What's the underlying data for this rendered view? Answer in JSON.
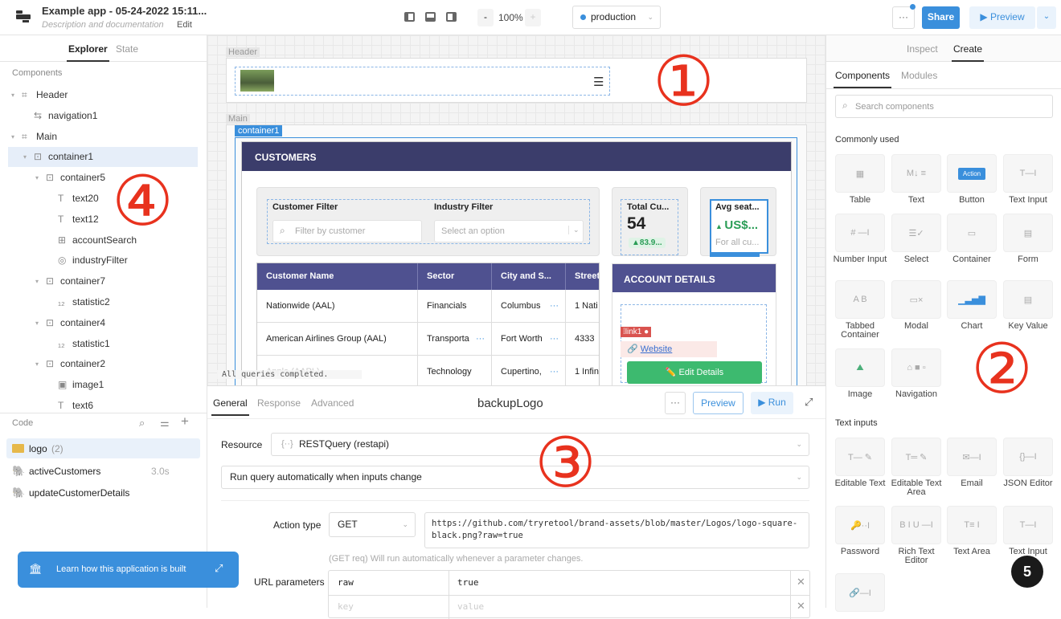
{
  "topbar": {
    "title": "Example app - 05-24-2022 15:11...",
    "subtitle": "Description and documentation",
    "edit": "Edit",
    "zoom_minus": "-",
    "zoom": "100%",
    "zoom_plus": "+",
    "environment": "production",
    "more": "···",
    "share": "Share",
    "preview": "Preview"
  },
  "left": {
    "tabs": [
      "Explorer",
      "State"
    ],
    "components_heading": "Components",
    "tree": [
      {
        "label": "Header",
        "icon": "frame-icon",
        "depth": 0,
        "caret": true
      },
      {
        "label": "navigation1",
        "icon": "navigation-icon",
        "depth": 1,
        "caret": false
      },
      {
        "label": "Main",
        "icon": "frame-icon",
        "depth": 0,
        "caret": true
      },
      {
        "label": "container1",
        "icon": "container-icon",
        "depth": 1,
        "caret": true,
        "selected": true
      },
      {
        "label": "container5",
        "icon": "container-icon",
        "depth": 2,
        "caret": true
      },
      {
        "label": "text20",
        "icon": "text-icon",
        "depth": 3,
        "caret": false
      },
      {
        "label": "text12",
        "icon": "text-icon",
        "depth": 3,
        "caret": false
      },
      {
        "label": "accountSearch",
        "icon": "text-input-icon",
        "depth": 3,
        "caret": false
      },
      {
        "label": "industryFilter",
        "icon": "select-icon",
        "depth": 3,
        "caret": false
      },
      {
        "label": "container7",
        "icon": "container-icon",
        "depth": 2,
        "caret": true
      },
      {
        "label": "statistic2",
        "icon": "statistic-icon",
        "depth": 3,
        "caret": false
      },
      {
        "label": "container4",
        "icon": "container-icon",
        "depth": 2,
        "caret": true
      },
      {
        "label": "statistic1",
        "icon": "statistic-icon",
        "depth": 3,
        "caret": false
      },
      {
        "label": "container2",
        "icon": "container-icon",
        "depth": 2,
        "caret": true
      },
      {
        "label": "image1",
        "icon": "image-icon",
        "depth": 3,
        "caret": false
      },
      {
        "label": "text6",
        "icon": "text-icon",
        "depth": 3,
        "caret": false
      }
    ],
    "code_heading": "Code",
    "code": [
      {
        "label": "logo",
        "count": "(2)",
        "icon": "folder-icon"
      },
      {
        "label": "activeCustomers",
        "time": "3.0s",
        "icon": "postgres-icon"
      },
      {
        "label": "updateCustomerDetails",
        "icon": "postgres-icon"
      }
    ],
    "learn": "Learn how this application is built"
  },
  "canvas": {
    "header_label": "Header",
    "main_label": "Main",
    "container_tag": "container1",
    "customers_title": "CUSTOMERS",
    "customer_filter": "Customer Filter",
    "customer_placeholder": "Filter by customer",
    "industry_filter": "Industry Filter",
    "industry_placeholder": "Select an option",
    "stat1": {
      "title": "Total Cu...",
      "value": "54",
      "delta": "83.9..."
    },
    "stat2": {
      "title": "Avg seat...",
      "value": "US$...",
      "sub": "For all cu..."
    },
    "table": {
      "columns": [
        "Customer Name",
        "Sector",
        "City and S...",
        "Street"
      ],
      "rows": [
        [
          "Nationwide (AAL)",
          "Financials",
          "Columbus",
          "1 Nati"
        ],
        [
          "American Airlines Group (AAL)",
          "Transporta",
          "Fort Worth",
          "4333"
        ],
        [
          "Apple (AAPL)",
          "Technology",
          "Cupertino,",
          "1 Infin"
        ]
      ]
    },
    "account_details": "ACCOUNT DETAILS",
    "link_tag": "link1",
    "website": "Website",
    "edit_details": "✏️ Edit Details",
    "status": "All queries completed."
  },
  "query": {
    "tabs": [
      "General",
      "Response",
      "Advanced"
    ],
    "name": "backupLogo",
    "more": "···",
    "preview": "Preview",
    "run": "Run",
    "resource_label": "Resource",
    "resource": "RESTQuery (restapi)",
    "trigger": "Run query automatically when inputs change",
    "action_label": "Action type",
    "method": "GET",
    "url": "https://github.com/tryretool/brand-assets/blob/master/Logos/logo-square-black.png?raw=true",
    "hint": "(GET req) Will run automatically whenever a parameter changes.",
    "params_label": "URL parameters",
    "params": [
      {
        "key": "raw",
        "value": "true"
      }
    ],
    "key_placeholder": "key",
    "value_placeholder": "value"
  },
  "right": {
    "tabs": [
      "Inspect",
      "Create"
    ],
    "subtabs": [
      "Components",
      "Modules"
    ],
    "search_placeholder": "Search components",
    "common_heading": "Commonly used",
    "common": [
      {
        "label": "Table",
        "glyph": "▦"
      },
      {
        "label": "Text",
        "glyph": "M↓ ≡"
      },
      {
        "label": "Button",
        "glyph": "Action"
      },
      {
        "label": "Text Input",
        "glyph": "T—I"
      },
      {
        "label": "Number Input",
        "glyph": "# —I"
      },
      {
        "label": "Select",
        "glyph": "☰✓"
      },
      {
        "label": "Container",
        "glyph": "▭"
      },
      {
        "label": "Form",
        "glyph": "▤"
      },
      {
        "label": "Tabbed Container",
        "glyph": "A B"
      },
      {
        "label": "Modal",
        "glyph": "▭×"
      },
      {
        "label": "Chart",
        "glyph": "▁▃▅▇"
      },
      {
        "label": "Key Value",
        "glyph": "▤"
      },
      {
        "label": "Image",
        "glyph": "⛰"
      },
      {
        "label": "Navigation",
        "glyph": "⌂ ■ ▫"
      }
    ],
    "text_heading": "Text inputs",
    "text_inputs": [
      {
        "label": "Editable Text",
        "glyph": "T— ✎"
      },
      {
        "label": "Editable Text Area",
        "glyph": "T═ ✎"
      },
      {
        "label": "Email",
        "glyph": "✉—I"
      },
      {
        "label": "JSON Editor",
        "glyph": "{}—I"
      },
      {
        "label": "Password",
        "glyph": "🔑··I"
      },
      {
        "label": "Rich Text Editor",
        "glyph": "B I U —I"
      },
      {
        "label": "Text Area",
        "glyph": "T≡ I"
      },
      {
        "label": "Text Input",
        "glyph": "T—I"
      },
      {
        "label": "",
        "glyph": "🔗—I"
      }
    ]
  },
  "annotations": [
    "①",
    "②",
    "③",
    "④"
  ],
  "help_badge": "5",
  "colors": {
    "accent": "#3a8fdc",
    "navy": "#3b3d6b",
    "table_header": "#4f5190",
    "green": "#3dba6f",
    "annotation": "#e8321e"
  }
}
